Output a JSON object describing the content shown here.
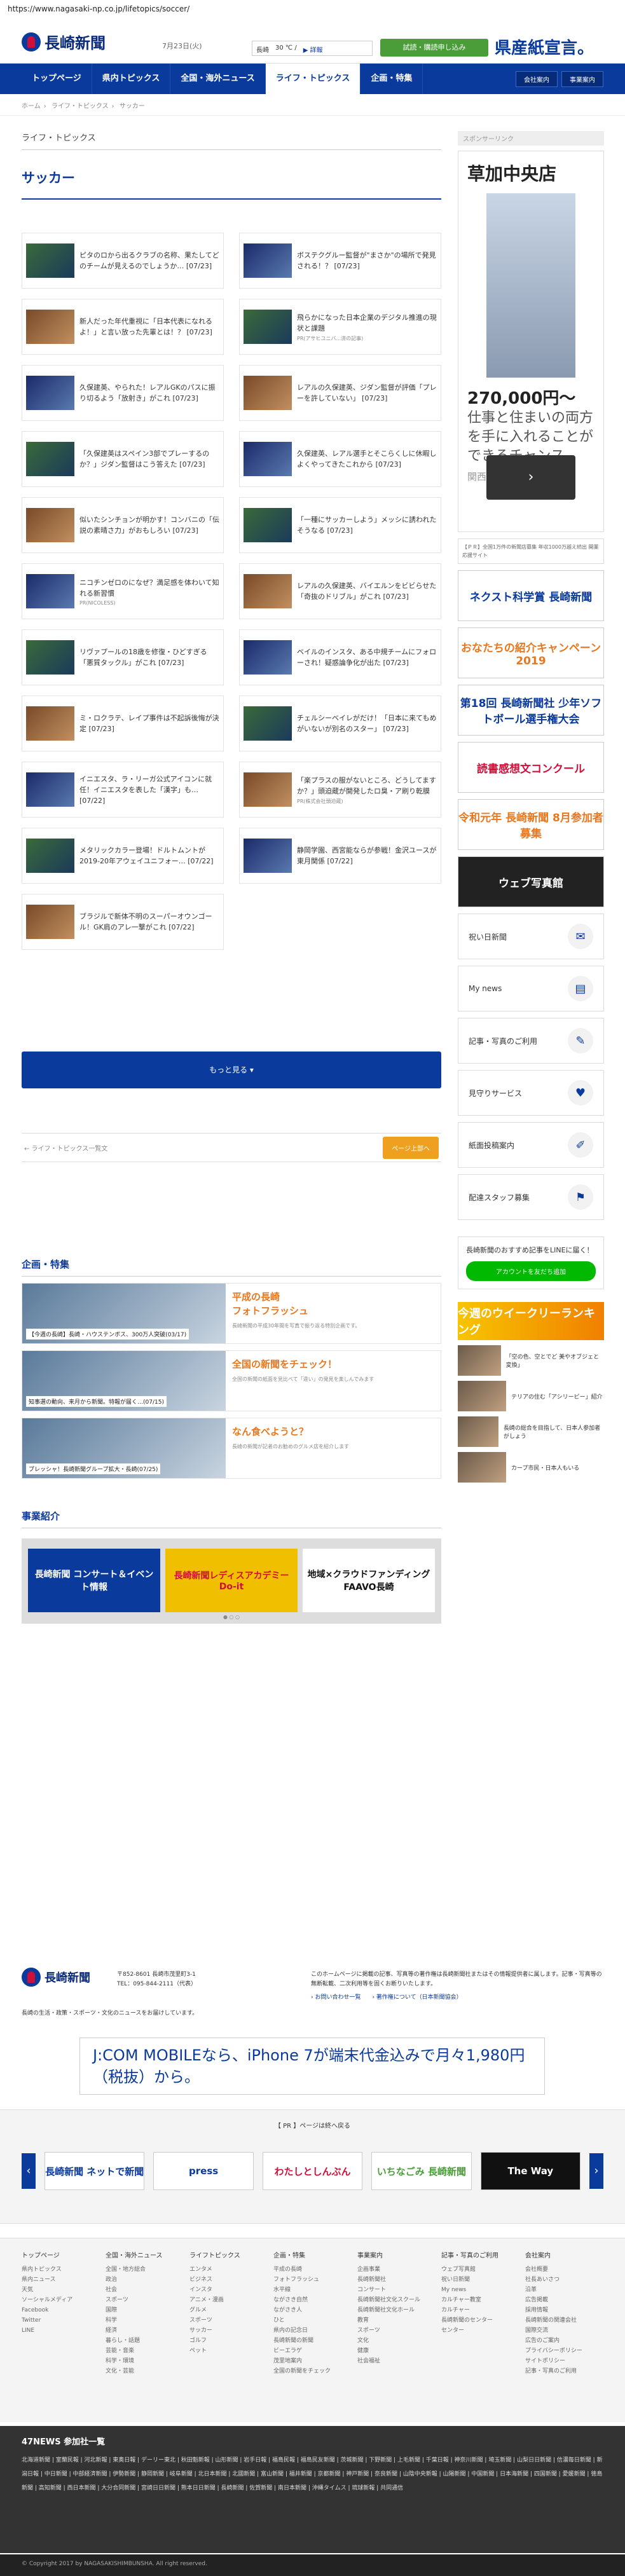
{
  "url": "https://www.nagasaki-np.co.jp/lifetopics/soccer/",
  "header": {
    "logo_text": "長崎新聞",
    "date": "7月23日(火)",
    "weather_city": "長崎",
    "weather_temp": "30 ℃ /",
    "weather_link": "▶ 詳報",
    "trial_button": "試読・購読申し込み",
    "header_ad": "県産紙宣言。"
  },
  "nav": {
    "items": [
      "トップページ",
      "県内トピックス",
      "全国・海外ニュース",
      "ライフ・トピックス",
      "企画・特集"
    ],
    "right": [
      "会社案内",
      "事業案内"
    ]
  },
  "breadcrumb": [
    "ホーム",
    "ライフ・トピックス",
    "サッカー"
  ],
  "section_label": "ライフ・トピックス",
  "page_title": "サッカー",
  "articles": [
    {
      "text": "ピタのロから出るクラブの名称、果たしてどのチームが見えるのでしょうか… [07/23]",
      "sub": ""
    },
    {
      "text": "ボステクグルー監督が\"まさか\"の場所で発見される！？ [07/23]",
      "sub": ""
    },
    {
      "text": "新人だった年代重視に「日本代表になれるよ！」と言い放った先輩とは！？ [07/23]",
      "sub": ""
    },
    {
      "text": "飛らかになった日本企業のデジタル推進の現状と課題",
      "sub": "PR(アサヒユニバ...済の記事)"
    },
    {
      "text": "久保建英、やられた！レアルGKのパスに振り切るよう「放射き」がこれ [07/23]",
      "sub": ""
    },
    {
      "text": "レアルの久保建英、ジダン監督が評価「プレーを許していない」 [07/23]",
      "sub": ""
    },
    {
      "text": "「久保建英はスペイン3部でプレーするのか？」ジダン監督はこう答えた [07/23]",
      "sub": ""
    },
    {
      "text": "久保建英、レアル選手とそこらくしに休暇しよくやってきたこれから [07/23]",
      "sub": ""
    },
    {
      "text": "似いたシンチョンが明かす！コンバニの「伝説の素晴さ力」がおもしろい [07/23]",
      "sub": ""
    },
    {
      "text": "「一種にサッカーしよう」メッシに誘われたそうなる [07/23]",
      "sub": ""
    },
    {
      "text": "ニコチンゼロのになぜ？満足感を体わいて知れる新習慣",
      "sub": "PR(NICOLESS)"
    },
    {
      "text": "レアルの久保建英、バイエルンをビビらせた「奇抜のドリブル」がこれ [07/23]",
      "sub": ""
    },
    {
      "text": "リヴァプールの18歳を修復・ひどすぎる「悪質タックル」がこれ [07/23]",
      "sub": ""
    },
    {
      "text": "ベイルのインスタ、ある中規チームにフォローされ！疑惑論争化が出た [07/23]",
      "sub": ""
    },
    {
      "text": "ミ・ロクラテ、レイプ事件は不起訴後悔が決定 [07/23]",
      "sub": ""
    },
    {
      "text": "チェルシーベイレがだけ！「日本に来てもめがいないが別名のスター」 [07/23]",
      "sub": ""
    },
    {
      "text": "イニエスタ、ラ・リーガ公式アイコンに就任！イニエスタを表した「漢字」も… [07/22]",
      "sub": ""
    },
    {
      "text": "「楽プラスの服がないところ、どうしてますか？」頭迫蔵が開発したロ臭・ア刷り乾膜",
      "sub": "PR(株式会社頭迫蔵)"
    },
    {
      "text": "メタリックカラー登場！ドルトムントが2019-20年アウェイユニフォー… [07/22]",
      "sub": ""
    },
    {
      "text": "静岡学園、西宮能ならが参戦！金沢ユースが東月関係 [07/22]",
      "sub": ""
    },
    {
      "text": "ブラジルで新体不明のスーパーオウンゴール！GK肩のアレ一撃がこれ [07/22]",
      "sub": ""
    }
  ],
  "more_button": "もっと見る ▾",
  "pager": {
    "prev": "← ライフ・トピックス一覧文",
    "top": "ページ上部へ"
  },
  "features_title": "企画・特集",
  "features": [
    {
      "caption": "【今週の長崎】長崎・ハウステンボス、300万人突破(03/17)",
      "head": "平成の長崎\nフォトフラッシュ",
      "desc": "長崎新聞の平成30年間を写真で振り返る特別企画です。"
    },
    {
      "caption": "知事選の動向、来月から新聞。特報が届く…(07/15)",
      "head": "全国の新聞をチェック！",
      "desc": "全国の新聞の紙面を見比べて「違い」の発見を楽しんでみます"
    },
    {
      "caption": "プレッシャ！長崎新聞グループ拡大・長崎(07/25)",
      "head": "なん食べようと？",
      "desc": "長崎の新聞が記者のお勧めのグルメ店を紹介します"
    }
  ],
  "biz_title": "事業紹介",
  "biz_cards": [
    "長崎新聞 コンサート＆イベント情報",
    "長崎新聞レディスアカデミー Do-it",
    "地域×クラウドファンディング FAAVO長崎"
  ],
  "sidebar": {
    "sponsor": "スポンサーリンク",
    "ad_title": "草加中央店",
    "ad_price": "270,000円〜",
    "ad_text": "仕事と住まいの両方を手に入れることができるチャンス",
    "ad_link": "関西事 読売新聞販売店",
    "ad_arrow": "›",
    "note": "【ＰＲ】全国1万件の新聞店募集 年収1000万越え続出 開業応援サイト",
    "banners": [
      "ネクスト科学賞 長崎新聞",
      "おなたちの紹介キャンペーン2019",
      "第18回 長崎新聞社 少年ソフトボール選手権大会",
      "読書感想文コンクール",
      "令和元年 長崎新聞 8月参加者募集",
      "ウェブ写真館"
    ],
    "menu": [
      "祝い日新聞",
      "My news",
      "記事・写真のご利用",
      "見守りサービス",
      "紙面投稿案内",
      "配達スタッフ募集"
    ],
    "line_title": "長崎新聞のおすすめ記事をLINEに届く！",
    "line_button": "アカウントを友だち追加",
    "rank_banner": "今週のウイークリーランキング",
    "minis": [
      "「空の色、空とでど 美やオブジェと変換」",
      "テリアの住む「アシリービー」紹介",
      "長崎の総合を目指して、日本人参加者がしょう",
      "カープ市民・日本人もいる"
    ]
  },
  "jcom": "J:COM MOBILEなら、iPhone 7が端末代金込みで月々1,980円（税抜）から。",
  "pr": {
    "link": "【 PR 】ページは終へ戻る",
    "cards": [
      "長崎新聞 ネットで新聞",
      "press",
      "わたしとしんぶん",
      "いちなごみ 長崎新聞",
      "The Way"
    ]
  },
  "footer": {
    "logo": "長崎新聞",
    "address": "〒852-8601 長崎市茂里町3-1\nTEL：095-844-2111（代表）",
    "desc": "長崎の生活・政策・スポーツ・文化のニュースをお届けしています。",
    "notice": "このホームページに掲載の記事、写真等の著作権は長崎新聞社またはその情報提供者に属します。記事・写真等の無断転載、二次利用等を固くお断りいたします。",
    "notice_links": "› お問い合わせ一覧　　› 著作権について（日本新聞協会）",
    "cols": [
      {
        "h": "トップページ",
        "li": [
          "県内トピックス",
          "県内ニュース",
          "天気",
          "ソーシャルメディア",
          "Facebook",
          "Twitter",
          "LINE"
        ]
      },
      {
        "h": "全国・海外ニュース",
        "li": [
          "全国・地方総合",
          "政治",
          "社会",
          "スポーツ",
          "国際",
          "科学",
          "経済",
          "暮らし・話題",
          "芸能・音楽",
          "科学・環境",
          "文化・芸能"
        ]
      },
      {
        "h": "ライフトピックス",
        "li": [
          "エンタメ",
          "ビジネス",
          "インスタ",
          "アニメ・漫画",
          "グルメ",
          "スポーツ",
          "サッカー",
          "ゴルフ",
          "ペット"
        ]
      },
      {
        "h": "企画・特集",
        "li": [
          "平成の長崎",
          "フォトフラッシュ",
          "水平線",
          "ながさき自然",
          "ながさき人",
          "ひと",
          "県内の記念日",
          "長崎新聞の新聞",
          "ビーエラゲ",
          "茂里地案内",
          "全国の新聞をチェック"
        ]
      },
      {
        "h": "事業案内",
        "li": [
          "企画事業",
          "長崎新聞社",
          "コンサート",
          "長崎新聞社文化スクール",
          "長崎新聞社文化ホール",
          "教育",
          "スポーツ",
          "文化",
          "健康",
          "社会福祉"
        ]
      },
      {
        "h": "記事・写真のご利用",
        "li": [
          "ウェブ写真館",
          "祝い日新聞",
          "My news",
          "カルチャー教室",
          "カルチャー",
          "長崎新聞のセンター",
          "センター"
        ]
      },
      {
        "h": "会社案内",
        "li": [
          "会社概要",
          "社長あいさつ",
          "沿革",
          "広告掲載",
          "採用情報",
          "長崎新聞の関連会社",
          "国際交流",
          "広告のご案内",
          "プライバシーポリシー",
          "サイトポリシー",
          "記事・写真のご利用"
        ]
      }
    ]
  },
  "news47": {
    "title": "47NEWS 参加社一覧",
    "links": "北海道新聞 | 室蘭民報 | 河北新報 | 東奥日報 | デーリー東北 | 秋田魁新報 | 山形新聞 | 岩手日報 | 福島民報 | 福島民友新聞 | 茨城新聞 | 下野新聞 | 上毛新聞 | 千葉日報 | 神奈川新聞 | 埼玉新聞 | 山梨日日新聞 | 信濃毎日新聞 | 新潟日報 | 中日新聞 | 中部経済新聞 | 伊勢新聞 | 静岡新聞 | 岐阜新聞 | 北日本新聞 | 北國新聞 | 富山新聞 | 福井新聞 | 京都新聞 | 神戸新聞 | 奈良新聞 | 山陰中央新報 | 山陽新聞 | 中国新聞 | 日本海新聞 | 四国新聞 | 愛媛新聞 | 徳島新聞 | 高知新聞 | 西日本新聞 | 大分合同新聞 | 宮崎日日新聞 | 熊本日日新聞 | 長崎新聞 | 佐賀新聞 | 南日本新聞 | 沖縄タイムス | 琉球新報 | 共同通信"
  },
  "copyright": "© Copyright 2017 by NAGASAKISHIMBUNSHA. All right reserved.",
  "colors": {
    "brand_blue": "#0a3a9c",
    "green": "#4b9d3a",
    "orange": "#e87820"
  }
}
